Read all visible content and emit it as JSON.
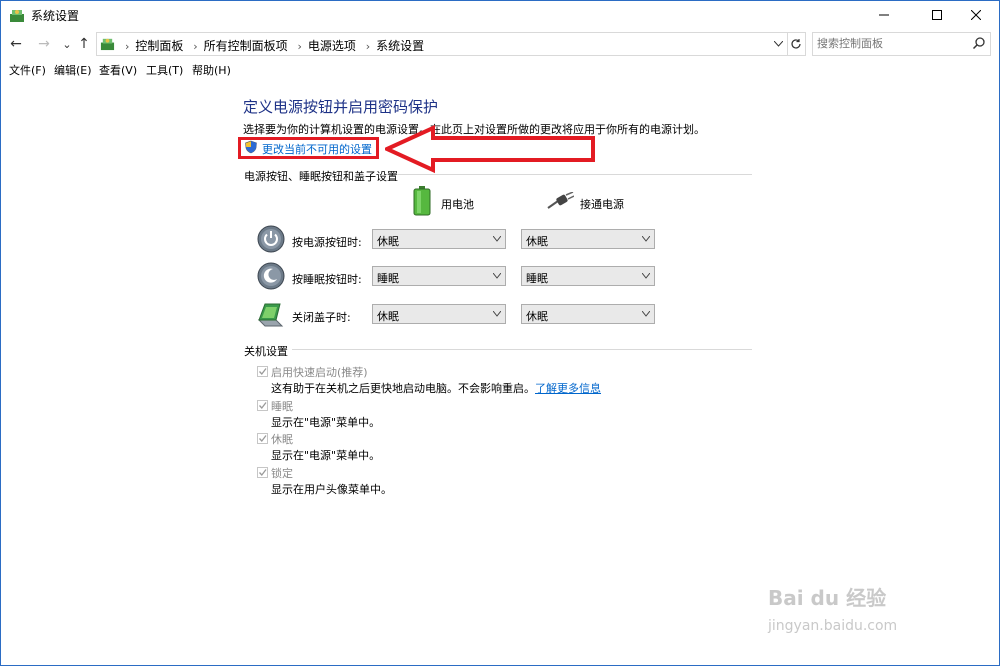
{
  "window": {
    "title": "系统设置"
  },
  "nav": {
    "back": "←",
    "forward": "→",
    "recent": "⌄",
    "up": "↑"
  },
  "address": {
    "crumbs": [
      "控制面板",
      "所有控制面板项",
      "电源选项",
      "系统设置"
    ]
  },
  "search": {
    "placeholder": "搜索控制面板"
  },
  "menu": [
    "文件(F)",
    "编辑(E)",
    "查看(V)",
    "工具(T)",
    "帮助(H)"
  ],
  "page": {
    "heading": "定义电源按钮并启用密码保护",
    "description": "选择要为你的计算机设置的电源设置。在此页上对设置所做的更改将应用于你所有的电源计划。",
    "change_link": "更改当前不可用的设置"
  },
  "buttons_section": {
    "title": "电源按钮、睡眠按钮和盖子设置",
    "col_battery": "用电池",
    "col_plugged": "接通电源",
    "rows": [
      {
        "label": "按电源按钮时:",
        "battery": "休眠",
        "plugged": "休眠",
        "icon": "power-button-icon"
      },
      {
        "label": "按睡眠按钮时:",
        "battery": "睡眠",
        "plugged": "睡眠",
        "icon": "sleep-button-icon"
      },
      {
        "label": "关闭盖子时:",
        "battery": "休眠",
        "plugged": "休眠",
        "icon": "laptop-lid-icon"
      }
    ]
  },
  "shutdown_section": {
    "title": "关机设置",
    "items": [
      {
        "label": "启用快速启动(推荐)",
        "desc": "这有助于在关机之后更快地启动电脑。不会影响重启。",
        "link": "了解更多信息",
        "checked": true
      },
      {
        "label": "睡眠",
        "desc": "显示在\"电源\"菜单中。",
        "checked": true
      },
      {
        "label": "休眠",
        "desc": "显示在\"电源\"菜单中。",
        "checked": true
      },
      {
        "label": "锁定",
        "desc": "显示在用户头像菜单中。",
        "checked": true
      }
    ]
  },
  "watermark": {
    "brand": "Bai du 经验",
    "url": "jingyan.baidu.com"
  },
  "colors": {
    "heading": "#1e3287",
    "link": "#0066cc",
    "highlight": "#e31b23",
    "border": "#2b6cc4"
  }
}
